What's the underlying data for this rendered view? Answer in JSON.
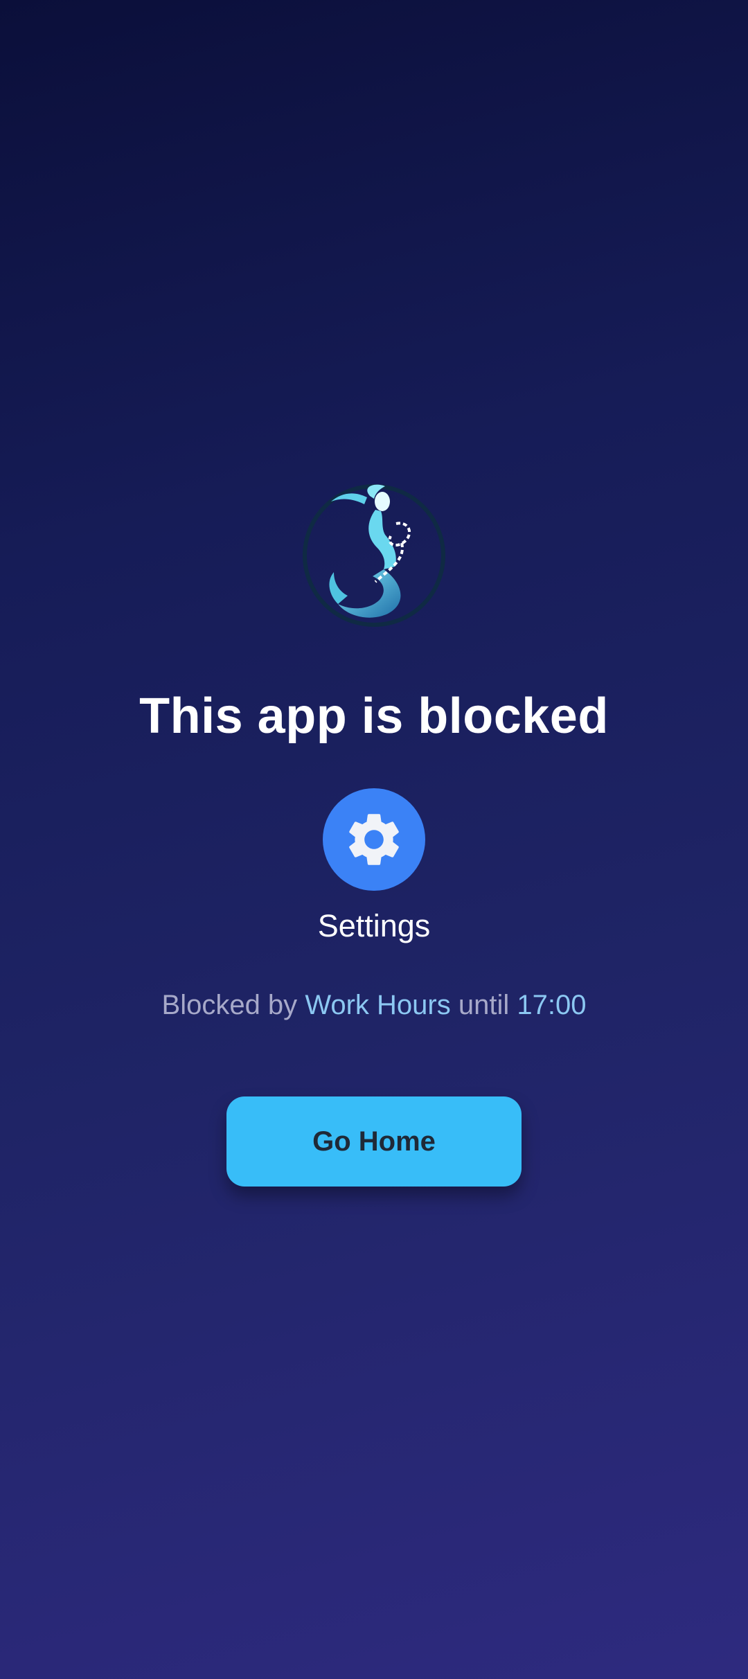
{
  "screen": {
    "title": "This app is blocked"
  },
  "blocked_app": {
    "name": "Settings",
    "icon": "gear-icon",
    "icon_background": "#3b82f6"
  },
  "block_info": {
    "prefix": "Blocked by",
    "rule_name": "Work Hours",
    "middle": "until",
    "until_time": "17:00"
  },
  "actions": {
    "go_home_label": "Go Home"
  },
  "logo": {
    "icon": "mermaid-logo-icon"
  },
  "colors": {
    "accent": "#8cc8f2",
    "button": "#38bdf8"
  }
}
